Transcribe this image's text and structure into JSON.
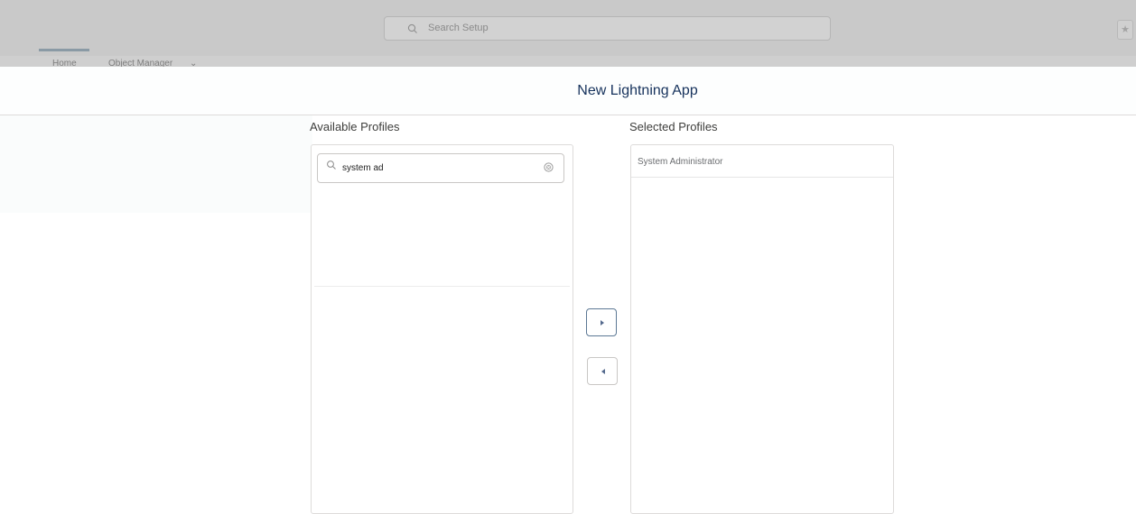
{
  "global_search": {
    "placeholder": "Search Setup"
  },
  "nav": {
    "items": [
      {
        "label": "Home"
      },
      {
        "label": "Object Manager"
      }
    ],
    "active_index": 0
  },
  "modal": {
    "title": "New Lightning App"
  },
  "available": {
    "label": "Available Profiles",
    "filter_value": "system ad"
  },
  "selected": {
    "label": "Selected Profiles",
    "items": [
      "System Administrator"
    ]
  },
  "buttons": {
    "move_right_icon": "chevron-right-icon",
    "move_left_icon": "chevron-left-icon"
  },
  "colors": {
    "focus_border": "#5c7894",
    "title": "#16325c"
  }
}
